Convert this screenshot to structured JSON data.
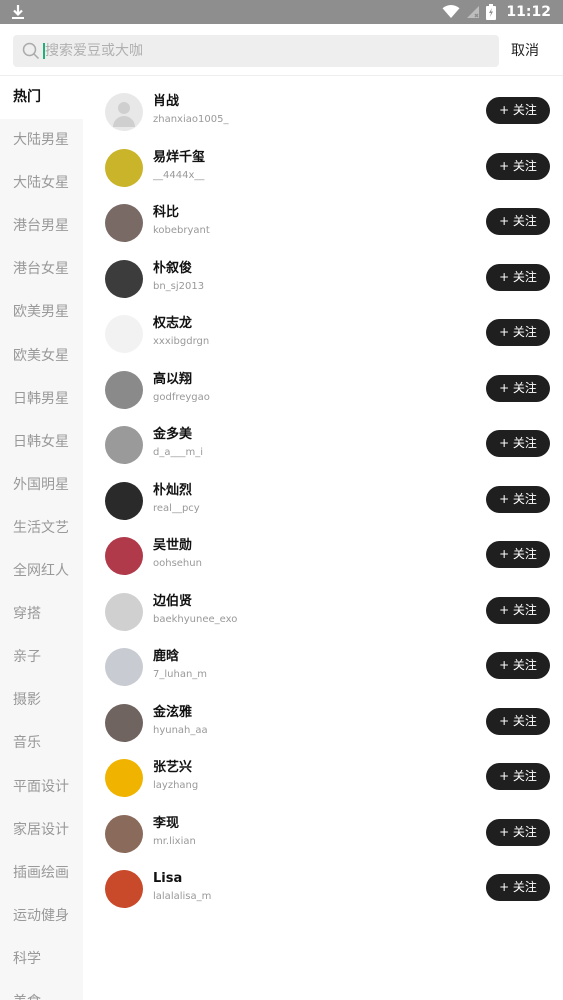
{
  "status_bar": {
    "time": "11:12"
  },
  "search": {
    "placeholder": "搜索爱豆或大咖",
    "cancel_label": "取消"
  },
  "categories": [
    "热门",
    "大陆男星",
    "大陆女星",
    "港台男星",
    "港台女星",
    "欧美男星",
    "欧美女星",
    "日韩男星",
    "日韩女星",
    "外国明星",
    "生活文艺",
    "全网红人",
    "穿搭",
    "亲子",
    "摄影",
    "音乐",
    "平面设计",
    "家居设计",
    "插画绘画",
    "运动健身",
    "科学",
    "美食"
  ],
  "active_category": "热门",
  "follow_label": "+ 关注",
  "celebrities": [
    {
      "name": "肖战",
      "handle": "zhanxiao1005_"
    },
    {
      "name": "易烊千玺",
      "handle": "__4444x__"
    },
    {
      "name": "科比",
      "handle": "kobebryant"
    },
    {
      "name": "朴叙俊",
      "handle": "bn_sj2013"
    },
    {
      "name": "权志龙",
      "handle": "xxxibgdrgn"
    },
    {
      "name": "高以翔",
      "handle": "godfreygao"
    },
    {
      "name": "金多美",
      "handle": "d_a___m_i"
    },
    {
      "name": "朴灿烈",
      "handle": "real__pcy"
    },
    {
      "name": "吴世勋",
      "handle": "oohsehun"
    },
    {
      "name": "边伯贤",
      "handle": "baekhyunee_exo"
    },
    {
      "name": "鹿晗",
      "handle": "7_luhan_m"
    },
    {
      "name": "金泫雅",
      "handle": "hyunah_aa"
    },
    {
      "name": "张艺兴",
      "handle": "layzhang"
    },
    {
      "name": "李现",
      "handle": "mr.lixian"
    },
    {
      "name": "Lisa",
      "handle": "lalalalisa_m"
    }
  ],
  "avatar_colors": [
    "#e8e8e8",
    "#c9b42a",
    "#7a6a66",
    "#3c3c3c",
    "#f2f2f2",
    "#8a8a8a",
    "#9a9a9a",
    "#2a2a2a",
    "#b03a4a",
    "#d0d0d0",
    "#c8ccd2",
    "#6f6460",
    "#f0b400",
    "#8a6a5a",
    "#c84a2a"
  ]
}
